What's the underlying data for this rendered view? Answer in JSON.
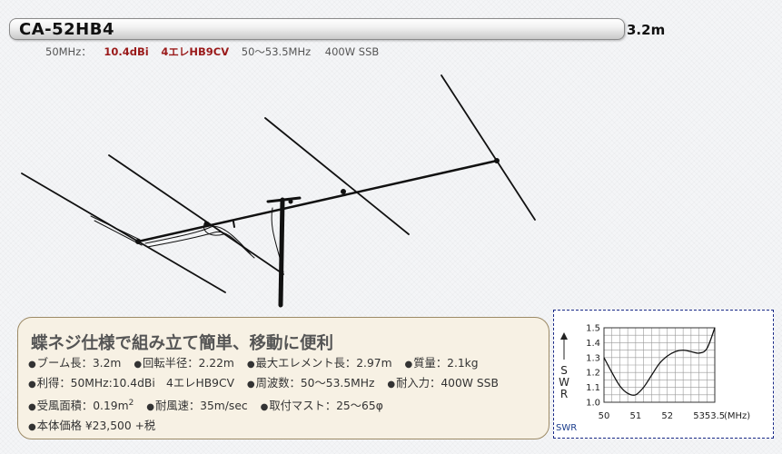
{
  "header": {
    "model": "CA-52HB4",
    "length": "3.2m"
  },
  "spec_line": {
    "band": "50MHz：",
    "gain": "10.4dBi",
    "elements": "4エレHB9CV",
    "freq_range": "50～53.5MHz",
    "power": "400W SSB"
  },
  "features": {
    "title": "蝶ネジ仕様で組み立て簡単、移動に便利",
    "rows": [
      [
        {
          "label": "ブーム長：3.2m"
        },
        {
          "label": "回転半径：2.22m"
        },
        {
          "label": "最大エレメント長：2.97m"
        },
        {
          "label": "質量：2.1kg"
        }
      ],
      [
        {
          "label": "利得：50MHz:10.4dBi　4エレHB9CV"
        },
        {
          "label": "周波数：50～53.5MHz"
        },
        {
          "label": "耐入力：400W SSB"
        }
      ],
      [
        {
          "label": "受風面積：0.19m",
          "sup": "2"
        },
        {
          "label": "耐風速：35m/sec"
        },
        {
          "label": "取付マスト：25～65φ"
        }
      ],
      [
        {
          "label": "本体価格 ¥23,500 +税"
        }
      ]
    ]
  },
  "swr_chart": {
    "caption": "SWR",
    "chart_data": {
      "type": "line",
      "title": "",
      "xlabel": "(MHz)",
      "ylabel": "SWR",
      "xlim": [
        50,
        53.5
      ],
      "ylim": [
        1.0,
        1.5
      ],
      "x_ticks": [
        "50",
        "51",
        "52",
        "53",
        "53.5"
      ],
      "y_ticks": [
        "1.0",
        "1.1",
        "1.2",
        "1.3",
        "1.4",
        "1.5"
      ],
      "grid": true,
      "series": [
        {
          "name": "",
          "x": [
            50.0,
            50.25,
            50.5,
            50.75,
            51.0,
            51.25,
            51.5,
            51.75,
            52.0,
            52.25,
            52.5,
            52.75,
            53.0,
            53.25,
            53.5
          ],
          "y": [
            1.3,
            1.2,
            1.11,
            1.06,
            1.05,
            1.1,
            1.18,
            1.26,
            1.31,
            1.34,
            1.35,
            1.34,
            1.33,
            1.36,
            1.5
          ]
        }
      ]
    }
  }
}
